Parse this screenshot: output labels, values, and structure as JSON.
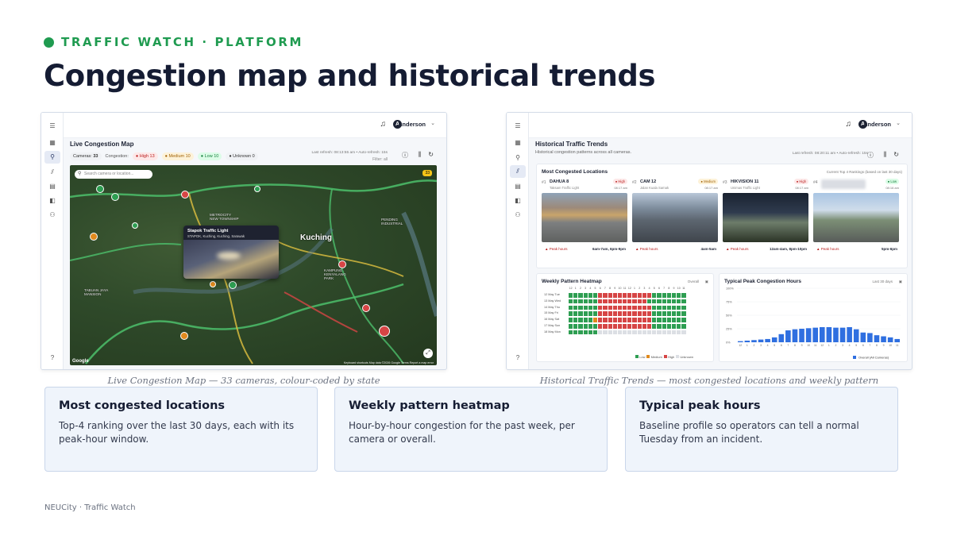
{
  "eyebrow": "TRAFFIC WATCH · PLATFORM",
  "headline": "Congestion map and historical trends",
  "shared": {
    "user": "Anderson",
    "avatar_initial": "A"
  },
  "left_shot": {
    "title": "Live Congestion Map",
    "refresh": "Last refresh: 08:13:55 am • Auto-refresh: 15s",
    "filter": "Filter: all",
    "legend": {
      "cameras_label": "Cameras:",
      "cameras": "33",
      "congestion_label": "Congestion:",
      "high": "● High 13",
      "medium": "● Medium 10",
      "low": "● Low 10",
      "unknown": "● Unknown 0"
    },
    "search_placeholder": "Search camera or location...",
    "count_badge": "33",
    "city": "Kuching",
    "popup_title": "Stapok Traffic Light",
    "popup_subtitle": "STAPOK, Kuching, Kuching, Sarawak",
    "google": "Google",
    "attribution": "Keyboard shortcuts   Map data ©2026 Google   Terms   Report a map error",
    "caption": "Live Congestion Map — 33 cameras, colour-coded by state"
  },
  "right_shot": {
    "title": "Historical Traffic Trends",
    "subtitle": "Historical congestion patterns across all cameras.",
    "refresh": "Last refresh: 08:20:11 am • Auto-refresh: 15s",
    "congested": {
      "title": "Most Congested Locations",
      "hint": "Current Top 4 Rankings (based on last 30 days)",
      "items": [
        {
          "rank": "#1",
          "name": "DAHUA 8",
          "sub": "Taksam Traffic Light",
          "badge": "● High",
          "level": "h",
          "time": "08:17 am",
          "peak_label": "▲ Peak hours",
          "hours": "6am-7am, 6pm-9pm"
        },
        {
          "rank": "#2",
          "name": "CAM 12",
          "sub": "Jalan Kuala Samak",
          "badge": "● Medium",
          "level": "m",
          "time": "08:17 am",
          "peak_label": "▲ Peak hours",
          "hours": "4am-5am"
        },
        {
          "rank": "#3",
          "name": "HIKVISION 11",
          "sub": "Unimas Traffic Light",
          "badge": "● High",
          "level": "h",
          "time": "08:17 am",
          "peak_label": "▲ Peak hours",
          "hours": "12am-4am, 8pm-10pm"
        },
        {
          "rank": "#4",
          "name": "",
          "sub": "",
          "badge": "● Low",
          "level": "l",
          "time": "08:16 am",
          "peak_label": "▲ Peak hours",
          "hours": "5pm-6pm"
        }
      ]
    },
    "heatmap": {
      "title": "Weekly Pattern Heatmap",
      "control": "Overall",
      "hours": [
        "12",
        "1",
        "2",
        "3",
        "4",
        "5",
        "6",
        "7",
        "8",
        "9",
        "10",
        "11",
        "12",
        "1",
        "2",
        "3",
        "4",
        "5",
        "6",
        "7",
        "8",
        "9",
        "10",
        "11"
      ],
      "days": [
        "12 May Tue",
        "13 May Wed",
        "14 May Thu",
        "15 May Fri",
        "16 May Sat",
        "17 May Sun",
        "18 May Mon"
      ],
      "legend": [
        "Low",
        "Medium",
        "High",
        "Unknown"
      ],
      "colors": {
        "low": "#2e9e52",
        "medium": "#e08a1e",
        "high": "#d64545",
        "unknown": "#dcdfe4"
      }
    },
    "peak": {
      "title": "Typical Peak Congestion Hours",
      "control": "Last 30 days",
      "yticks": [
        "100%",
        "75%",
        "50%",
        "25%",
        "0%"
      ],
      "legend": "Overall (All Cameras)",
      "bar_color": "#2f6fe0"
    },
    "caption": "Historical Traffic Trends — most congested locations and weekly pattern"
  },
  "features": [
    {
      "title": "Most congested locations",
      "body": "Top-4 ranking over the last 30 days, each with its peak-hour window."
    },
    {
      "title": "Weekly pattern heatmap",
      "body": "Hour-by-hour congestion for the past week, per camera or overall."
    },
    {
      "title": "Typical peak hours",
      "body": "Baseline profile so operators can tell a normal Tuesday from an incident."
    }
  ],
  "footer": "NEUCity · Traffic Watch",
  "chart_data": {
    "type": "bar",
    "title": "Typical Peak Congestion Hours",
    "categories": [
      "12am",
      "1",
      "2",
      "3",
      "4",
      "5",
      "6",
      "7",
      "8",
      "9",
      "10",
      "11",
      "12pm",
      "1",
      "2",
      "3",
      "4",
      "5",
      "6",
      "7",
      "8",
      "9",
      "10",
      "11"
    ],
    "series": [
      {
        "name": "Overall (All Cameras)",
        "values": [
          2,
          3,
          4,
          5,
          6,
          9,
          15,
          22,
          24,
          25,
          26,
          27,
          28,
          28,
          27,
          27,
          28,
          24,
          18,
          17,
          13,
          11,
          9,
          6
        ]
      }
    ],
    "yticks": [
      "100%",
      "75%",
      "50%",
      "25%",
      "0%"
    ],
    "ylim": [
      0,
      100
    ]
  }
}
